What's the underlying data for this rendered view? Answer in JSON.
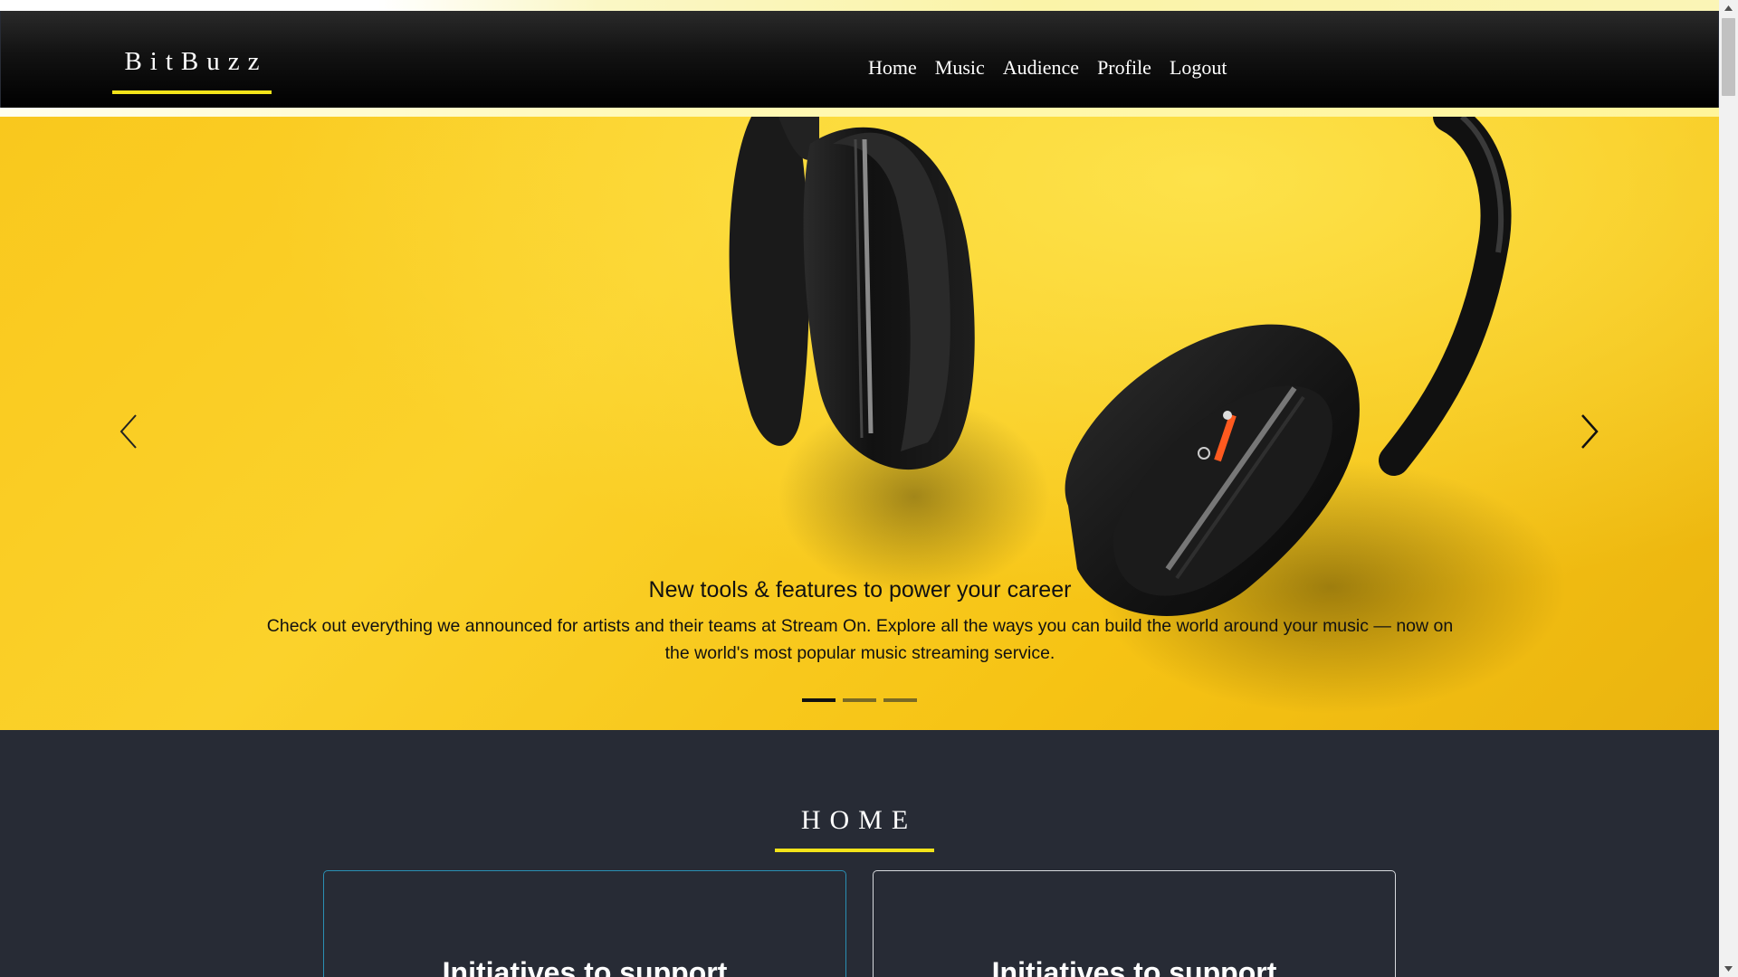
{
  "brand": {
    "name": "BitBuzz"
  },
  "nav": {
    "items": [
      {
        "label": "Home"
      },
      {
        "label": "Music"
      },
      {
        "label": "Audience"
      },
      {
        "label": "Profile"
      },
      {
        "label": "Logout"
      }
    ]
  },
  "carousel": {
    "active_slide": 1,
    "slide_count": 3,
    "caption_title": "New tools & features to power your career",
    "caption_text": "Check out everything we announced for artists and their teams at Stream On. Explore all the ways you can build the world around your music — now on the world's most popular music streaming service.",
    "prev_icon": "chevron-left-icon",
    "next_icon": "chevron-right-icon",
    "background_color": "#f9c81d"
  },
  "section": {
    "title": "HOME",
    "accent": "#f2e31a"
  },
  "cards": [
    {
      "title": "Initiatives to support"
    },
    {
      "title": "Initiatives to support"
    }
  ],
  "colors": {
    "navbar": "#000000",
    "page_bg": "#272b35",
    "accent": "#f2e31a"
  }
}
